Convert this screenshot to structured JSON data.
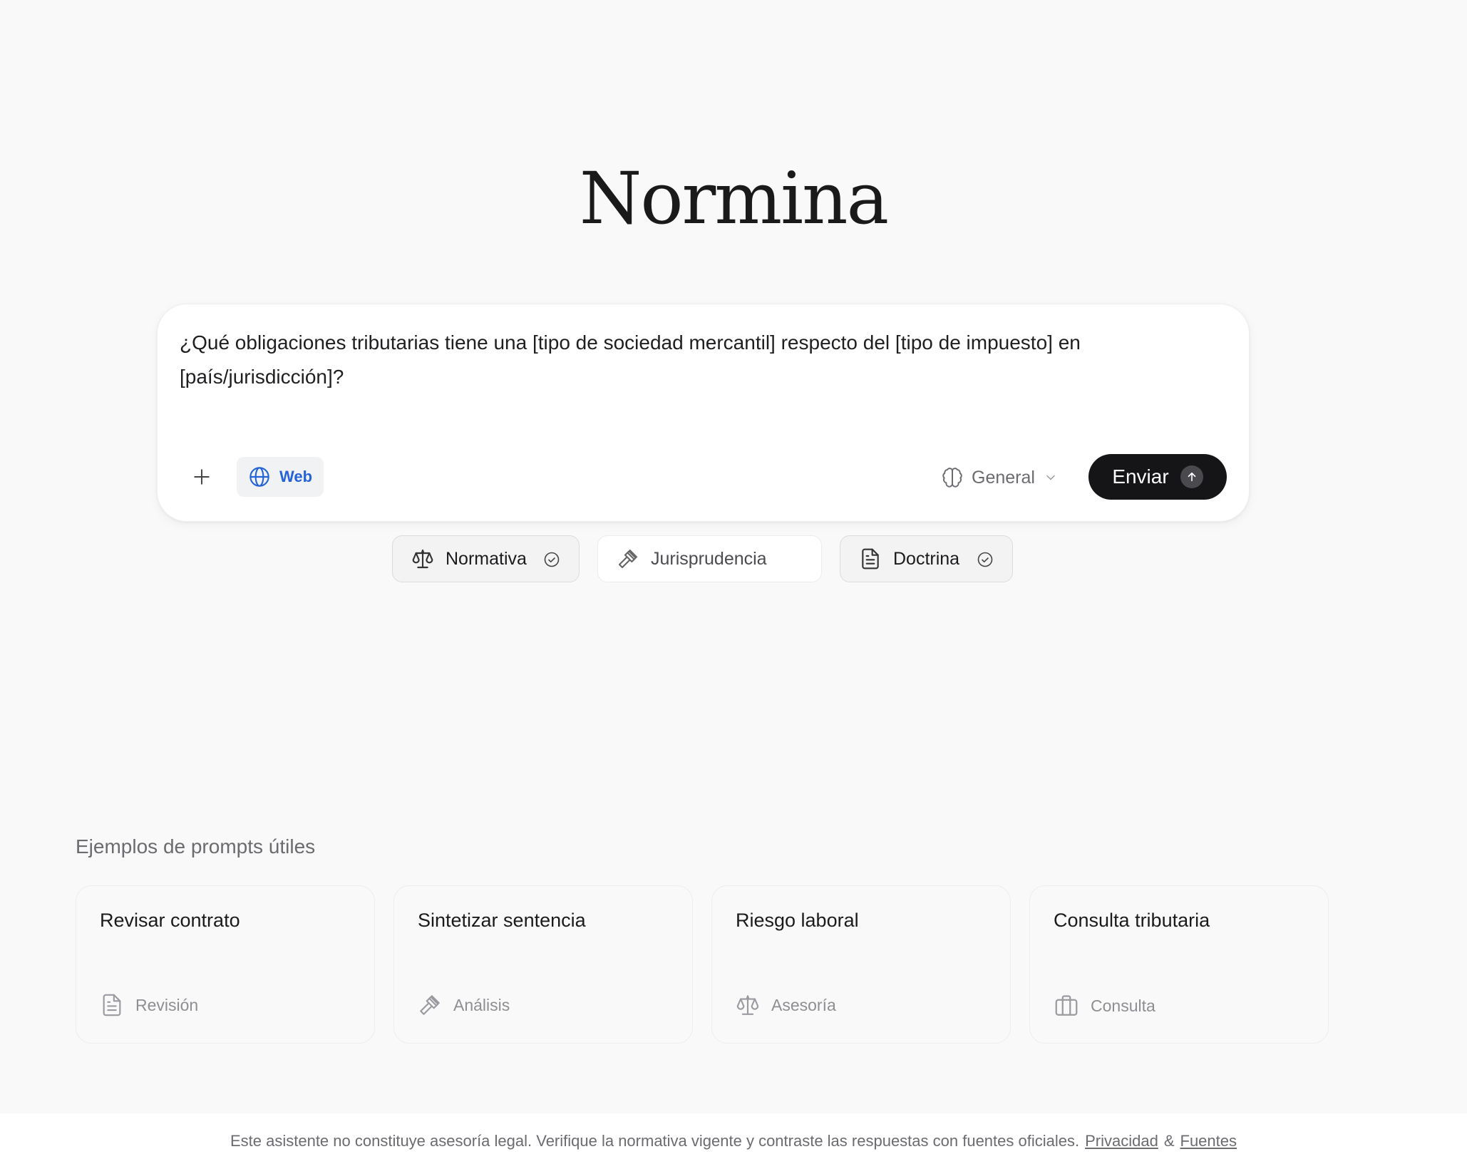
{
  "app": {
    "title": "Normina"
  },
  "composer": {
    "prompt_value": "¿Qué obligaciones tributarias tiene una [tipo de sociedad mercantil] respecto del [tipo de impuesto] en [país/jurisdicción]?",
    "web_label": "Web",
    "mode_label": "General",
    "send_label": "Enviar",
    "accent_color": "#2563d8"
  },
  "sources": [
    {
      "label": "Normativa",
      "icon": "scale-icon",
      "selected": true
    },
    {
      "label": "Jurisprudencia",
      "icon": "gavel-icon",
      "selected": false
    },
    {
      "label": "Doctrina",
      "icon": "document-icon",
      "selected": true
    }
  ],
  "examples": {
    "heading": "Ejemplos de prompts útiles",
    "cards": [
      {
        "title": "Revisar contrato",
        "tag": "Revisión",
        "icon": "document-icon"
      },
      {
        "title": "Sintetizar sentencia",
        "tag": "Análisis",
        "icon": "gavel-icon"
      },
      {
        "title": "Riesgo laboral",
        "tag": "Asesoría",
        "icon": "scale-icon"
      },
      {
        "title": "Consulta tributaria",
        "tag": "Consulta",
        "icon": "briefcase-icon"
      }
    ]
  },
  "footer": {
    "disclaimer": "Este asistente no constituye asesoría legal. Verifique la normativa vigente y contraste las respuestas con fuentes oficiales.",
    "privacy_link": "Privacidad",
    "separator": "&",
    "sources_link": "Fuentes"
  }
}
